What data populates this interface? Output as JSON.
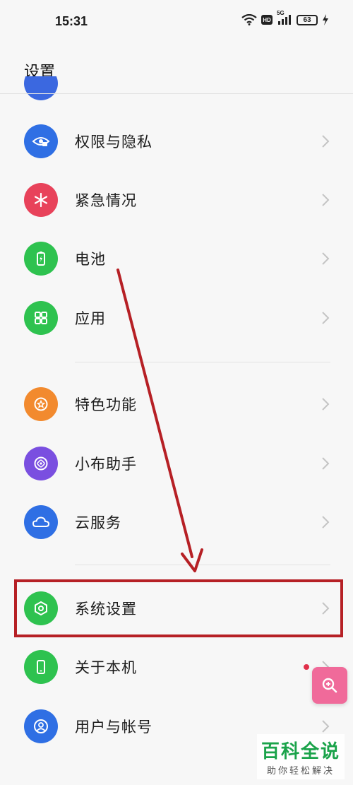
{
  "status_bar": {
    "time": "15:31",
    "network": "5G",
    "hd": "HD",
    "battery": "63"
  },
  "page": {
    "title": "设置"
  },
  "settings_groups": [
    {
      "items": [
        {
          "label": "权限与隐私",
          "icon": "eye-lock-icon",
          "color": "#2f6fe4"
        },
        {
          "label": "紧急情况",
          "icon": "asterisk-icon",
          "color": "#e8425a"
        },
        {
          "label": "电池",
          "icon": "battery-icon",
          "color": "#2ec24f"
        },
        {
          "label": "应用",
          "icon": "apps-grid-icon",
          "color": "#2ec24f"
        }
      ]
    },
    {
      "items": [
        {
          "label": "特色功能",
          "icon": "star-icon",
          "color": "#f28a2e"
        },
        {
          "label": "小布助手",
          "icon": "assistant-icon",
          "color": "#7a4fe0"
        },
        {
          "label": "云服务",
          "icon": "cloud-icon",
          "color": "#2f6fe4"
        }
      ]
    },
    {
      "items": [
        {
          "label": "系统设置",
          "icon": "hexagon-gear-icon",
          "color": "#2ec24f"
        },
        {
          "label": "关于本机",
          "icon": "phone-icon",
          "color": "#2ec24f"
        },
        {
          "label": "用户与帐号",
          "icon": "user-icon",
          "color": "#2f6fe4"
        }
      ]
    }
  ],
  "annotation": {
    "highlight_color": "#b62025",
    "highlighted_item": "系统设置"
  },
  "watermark": {
    "title": "百科全说",
    "subtitle": "助你轻松解决"
  }
}
